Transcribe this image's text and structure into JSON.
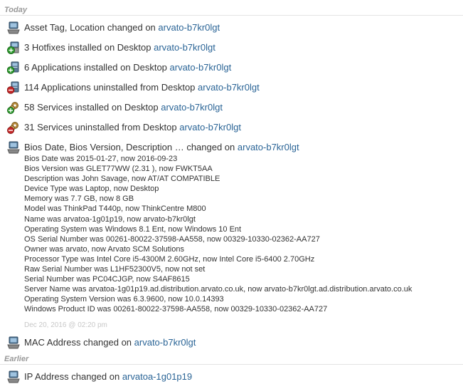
{
  "sections": {
    "today": "Today",
    "earlier": "Earlier"
  },
  "events": [
    {
      "text": "Asset Tag, Location changed on ",
      "link": "arvato-b7kr0lgt",
      "icon": "computer-icon"
    },
    {
      "text": "3 Hotfixes installed on Desktop ",
      "link": "arvato-b7kr0lgt",
      "icon": "hotfix-install-icon"
    },
    {
      "text": "6 Applications installed on Desktop ",
      "link": "arvato-b7kr0lgt",
      "icon": "app-install-icon"
    },
    {
      "text": "114 Applications uninstalled from Desktop ",
      "link": "arvato-b7kr0lgt",
      "icon": "app-uninstall-icon"
    },
    {
      "text": "58 Services installed on Desktop ",
      "link": "arvato-b7kr0lgt",
      "icon": "service-install-icon"
    },
    {
      "text": "31 Services uninstalled from Desktop ",
      "link": "arvato-b7kr0lgt",
      "icon": "service-uninstall-icon"
    },
    {
      "text": "Bios Date, Bios Version, Description … changed on ",
      "link": "arvato-b7kr0lgt",
      "icon": "computer-icon"
    },
    {
      "text": "MAC Address changed on ",
      "link": "arvato-b7kr0lgt",
      "icon": "computer-icon"
    },
    {
      "text": "IP Address changed on ",
      "link": "arvatoa-1g01p19",
      "icon": "computer-icon"
    }
  ],
  "details": [
    "Bios Date was 2015-01-27, now 2016-09-23",
    "Bios Version was GLET77WW (2.31 ), now FWKT5AA",
    "Description was John Savage, now AT/AT COMPATIBLE",
    "Device Type was Laptop, now Desktop",
    "Memory was 7.7 GB, now 8 GB",
    "Model was ThinkPad T440p, now ThinkCentre M800",
    "Name was arvatoa-1g01p19, now arvato-b7kr0lgt",
    "Operating System was Windows 8.1 Ent, now Windows 10 Ent",
    "OS Serial Number was 00261-80022-37598-AA558, now 00329-10330-02362-AA727",
    "Owner was arvato, now Arvato SCM Solutions",
    "Processor Type was Intel Core i5-4300M 2.60GHz, now Intel Core i5-6400 2.70GHz",
    "Raw Serial Number was L1HF52300V5, now not set",
    "Serial Number was PC04CJGP, now S4AF8615",
    "Server Name was arvatoa-1g01p19.ad.distribution.arvato.co.uk, now arvato-b7kr0lgt.ad.distribution.arvato.co.uk",
    "Operating System Version was 6.3.9600, now 10.0.14393",
    "Windows Product ID was 00261-80022-37598-AA558, now 00329-10330-02362-AA727"
  ],
  "timestamp": "Dec 20, 2016 @ 02:20 pm",
  "colors": {
    "link": "#2a6496",
    "section": "#999999",
    "timestamp": "#c8c8c8"
  }
}
